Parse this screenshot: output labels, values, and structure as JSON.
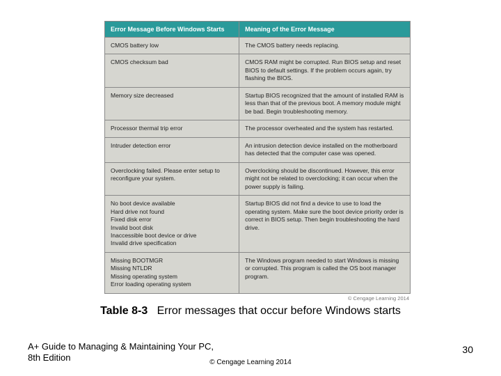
{
  "table": {
    "headers": [
      "Error Message Before Windows Starts",
      "Meaning of the Error Message"
    ],
    "rows": [
      {
        "error": "CMOS battery low",
        "meaning": "The CMOS battery needs replacing."
      },
      {
        "error": "CMOS checksum bad",
        "meaning": "CMOS RAM might be corrupted. Run BIOS setup and reset BIOS to default settings. If the problem occurs again, try flashing the BIOS."
      },
      {
        "error": "Memory size decreased",
        "meaning": "Startup BIOS recognized that the amount of installed RAM is less than that of the previous boot. A memory module might be bad. Begin troubleshooting memory."
      },
      {
        "error": "Processor thermal trip error",
        "meaning": "The processor overheated and the system has restarted."
      },
      {
        "error": "Intruder detection error",
        "meaning": "An intrusion detection device installed on the motherboard has detected that the computer case was opened."
      },
      {
        "error": "Overclocking failed. Please enter setup to reconfigure your system.",
        "meaning": "Overclocking should be discontinued. However, this error might not be related to overclocking; it can occur when the power supply is failing."
      },
      {
        "error": "No boot device available\nHard drive not found\nFixed disk error\nInvalid boot disk\nInaccessible boot device or drive\nInvalid drive specification",
        "meaning": "Startup BIOS did not find a device to use to load the operating system. Make sure the boot device priority order is correct in BIOS setup. Then begin troubleshooting the hard drive."
      },
      {
        "error": "Missing BOOTMGR\nMissing NTLDR\nMissing operating system\nError loading operating system",
        "meaning": "The Windows program needed to start Windows is missing or corrupted. This program is called the OS boot manager program."
      }
    ],
    "credit": "© Cengage Learning 2014"
  },
  "caption": {
    "label": "Table 8-3",
    "text": "Error messages that occur before Windows starts"
  },
  "footer": {
    "left": "A+ Guide to Managing & Maintaining Your PC, 8th Edition",
    "center": "© Cengage Learning  2014",
    "page": "30"
  },
  "chart_data": {
    "type": "table",
    "title": "Table 8-3  Error messages that occur before Windows starts",
    "columns": [
      "Error Message Before Windows Starts",
      "Meaning of the Error Message"
    ],
    "rows": [
      [
        "CMOS battery low",
        "The CMOS battery needs replacing."
      ],
      [
        "CMOS checksum bad",
        "CMOS RAM might be corrupted. Run BIOS setup and reset BIOS to default settings. If the problem occurs again, try flashing the BIOS."
      ],
      [
        "Memory size decreased",
        "Startup BIOS recognized that the amount of installed RAM is less than that of the previous boot. A memory module might be bad. Begin troubleshooting memory."
      ],
      [
        "Processor thermal trip error",
        "The processor overheated and the system has restarted."
      ],
      [
        "Intruder detection error",
        "An intrusion detection device installed on the motherboard has detected that the computer case was opened."
      ],
      [
        "Overclocking failed. Please enter setup to reconfigure your system.",
        "Overclocking should be discontinued. However, this error might not be related to overclocking; it can occur when the power supply is failing."
      ],
      [
        "No boot device available; Hard drive not found; Fixed disk error; Invalid boot disk; Inaccessible boot device or drive; Invalid drive specification",
        "Startup BIOS did not find a device to use to load the operating system. Make sure the boot device priority order is correct in BIOS setup. Then begin troubleshooting the hard drive."
      ],
      [
        "Missing BOOTMGR; Missing NTLDR; Missing operating system; Error loading operating system",
        "The Windows program needed to start Windows is missing or corrupted. This program is called the OS boot manager program."
      ]
    ]
  }
}
